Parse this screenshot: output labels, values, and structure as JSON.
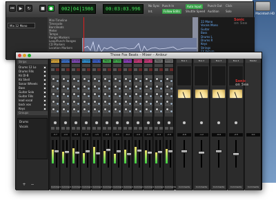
{
  "editor": {
    "clock_primary": "002|04|1986",
    "clock_secondary": "00:03:03.996",
    "sync_label": "No Sync",
    "int_label": "Int.",
    "chips": [
      {
        "label": "Follow Edits",
        "color": "#3aa34a"
      },
      {
        "label": "Auto Input",
        "color": "#3aa34a"
      }
    ],
    "menu_labels": [
      "Punch In",
      "Punch Out",
      "Audition",
      "Click",
      "Solo",
      "Shuttle Speed"
    ],
    "track_name": "Mix 12 Mono",
    "ruler_rows": [
      "Mini-Timeline",
      "Timecode",
      "Bars:Beats",
      "Meter",
      "Tempo",
      "Range Markers",
      "Loop/Punch Ranges",
      "CD Markers",
      "Location Markers"
    ],
    "list_items": [
      "22 Mono",
      "Vocals Mono",
      "Guitar",
      "Bass",
      "Drums L",
      "Drums R",
      "Keys",
      "Strings",
      "FX Return",
      "Click",
      "Mic Room"
    ]
  },
  "brand": {
    "line1": "Sonic",
    "line2": "on Sea"
  },
  "mixer": {
    "title": "Those Fox Beats – Mixer – Ardour",
    "sidebar_header": "Strips",
    "sidebar_items": [
      {
        "label": "Drums 12 Lo",
        "checked": true
      },
      {
        "label": "Drums Fills",
        "checked": true
      },
      {
        "label": "Kk DI-B",
        "checked": true
      },
      {
        "label": "Kk Shell",
        "checked": true
      },
      {
        "label": "Sonar Wheels",
        "checked": true
      },
      {
        "label": "Bass",
        "checked": true
      },
      {
        "label": "Guitar Solo",
        "checked": true
      },
      {
        "label": "Guitar Fills",
        "checked": true
      },
      {
        "label": "lead vocal",
        "checked": true
      },
      {
        "label": "back vox",
        "checked": true
      },
      {
        "label": "Keys",
        "checked": true
      }
    ],
    "sidebar_group_header": "Groups",
    "sidebar_group_items": [
      "Drums",
      "Vocals"
    ],
    "bottom_buttons": [
      "+",
      "−"
    ],
    "strips": [
      {
        "name": "Drums 12 Lo",
        "color": "#d7a63a",
        "value": "-3.7",
        "level": 0.58,
        "fader": 0.62,
        "foot": "Comments"
      },
      {
        "name": "Drum Fill",
        "color": "#3b6fc6",
        "value": "-2.0",
        "level": 0.5,
        "fader": 0.58,
        "foot": "Comments"
      },
      {
        "name": "Kk DI-B",
        "color": "#7f4ab5",
        "value": "-5.3",
        "level": 0.66,
        "fader": 0.55,
        "foot": "Comments"
      },
      {
        "name": "Kk Shell",
        "color": "#2f8fd0",
        "value": "-3.4",
        "level": 0.45,
        "fader": 0.6,
        "foot": "Comments"
      },
      {
        "name": "Sonar W",
        "color": "#3b5fc6",
        "value": "-1.5",
        "level": 0.7,
        "fader": 0.52,
        "foot": "Comments"
      },
      {
        "name": "Bass",
        "color": "#3fa54b",
        "value": "-4.0",
        "level": 0.52,
        "fader": 0.66,
        "foot": "Comments"
      },
      {
        "name": "Gtr Solo",
        "color": "#3fa54b",
        "value": "-2.1",
        "level": 0.4,
        "fader": 0.6,
        "foot": "Comments"
      },
      {
        "name": "Gtr Fills",
        "color": "#8b3fb8",
        "value": "-6.2",
        "level": 0.6,
        "fader": 0.5,
        "foot": "Comments"
      },
      {
        "name": "lead vox",
        "color": "#c83a7a",
        "value": "-1.0",
        "level": 0.72,
        "fader": 0.64,
        "foot": "Comments"
      },
      {
        "name": "back vox",
        "color": "#c83a7a",
        "value": "-3.3",
        "level": 0.55,
        "fader": 0.56,
        "foot": "Comments"
      },
      {
        "name": "Keys",
        "color": "#6c6c6c",
        "value": "-4.4",
        "level": 0.48,
        "fader": 0.58,
        "foot": "Comments"
      },
      {
        "name": "Strings",
        "color": "#6c6c6c",
        "value": "-2.9",
        "level": 0.62,
        "fader": 0.6,
        "foot": "Comments"
      }
    ],
    "buses": [
      {
        "name": "Bus 1",
        "value": "-0.6",
        "fader": 0.6,
        "foot": "Comments"
      },
      {
        "name": "Bus 2",
        "value": "-1.2",
        "fader": 0.55,
        "foot": "Comments"
      },
      {
        "name": "Bus 3",
        "value": "-0.9",
        "fader": 0.62,
        "foot": "Comments"
      },
      {
        "name": "Bus 4",
        "value": "-2.5",
        "fader": 0.5,
        "foot": "Comments"
      }
    ],
    "master": {
      "name": "Master",
      "value": "0.0",
      "foot": "Comments"
    }
  },
  "desktop": {
    "icon_label": "Macintosh HD"
  }
}
